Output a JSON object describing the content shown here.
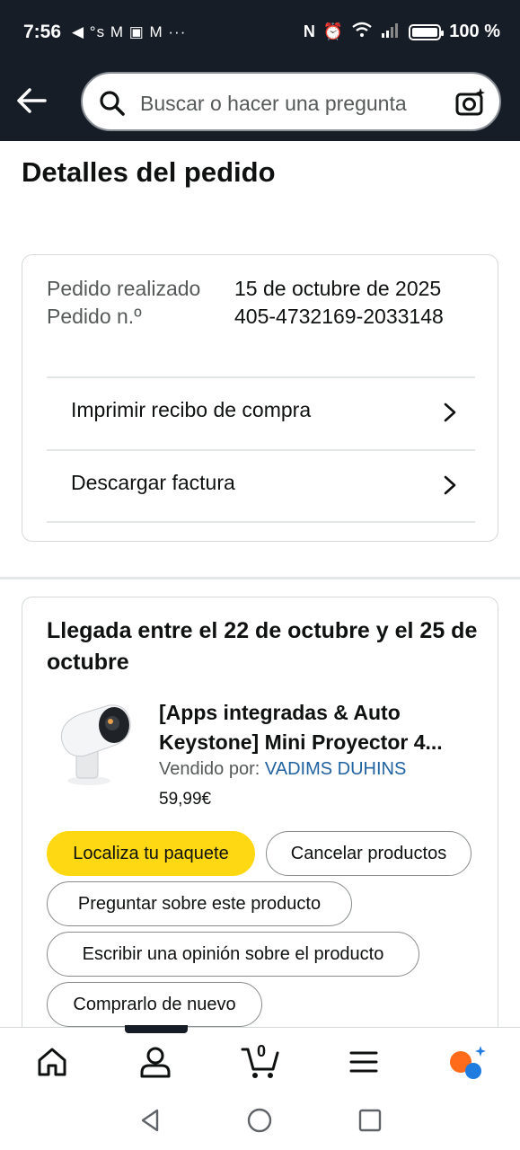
{
  "status_bar": {
    "time": "7:56",
    "notification_icons": "◀ °s M ▣ M ···",
    "battery": "100 %"
  },
  "header": {
    "back_icon": "arrow-left",
    "search_placeholder": "Buscar o hacer una pregunta",
    "camera_icon": "camera-sparkle"
  },
  "page": {
    "title": "Detalles del pedido"
  },
  "order_info": {
    "placed_label": "Pedido realizado",
    "placed_value": "15 de octubre de 2025",
    "number_label": "Pedido n.º",
    "number_value": "405-4732169-2033148",
    "links": [
      {
        "label": "Imprimir recibo de compra"
      },
      {
        "label": "Descargar factura"
      }
    ]
  },
  "shipment": {
    "arrival": "Llegada entre el 22 de octubre y el 25 de octubre",
    "product": {
      "title": "[Apps integradas & Auto Keystone] Mini Proyector 4...",
      "seller_label": "Vendido por:",
      "seller_name": "VADIMS DUHINS",
      "price": "59,99€"
    },
    "buttons": {
      "track": "Localiza tu paquete",
      "cancel": "Cancelar productos",
      "ask": "Preguntar sobre este producto",
      "review": "Escribir una opinión sobre el producto",
      "buy_again": "Comprarlo de nuevo"
    }
  },
  "bottom_nav": {
    "cart_count": "0",
    "items": [
      "home-icon",
      "account-icon",
      "cart-icon",
      "menu-icon",
      "assistant-icon"
    ]
  },
  "colors": {
    "header_bg": "#161d27",
    "primary_button": "#ffd814",
    "link": "#2162a1"
  }
}
